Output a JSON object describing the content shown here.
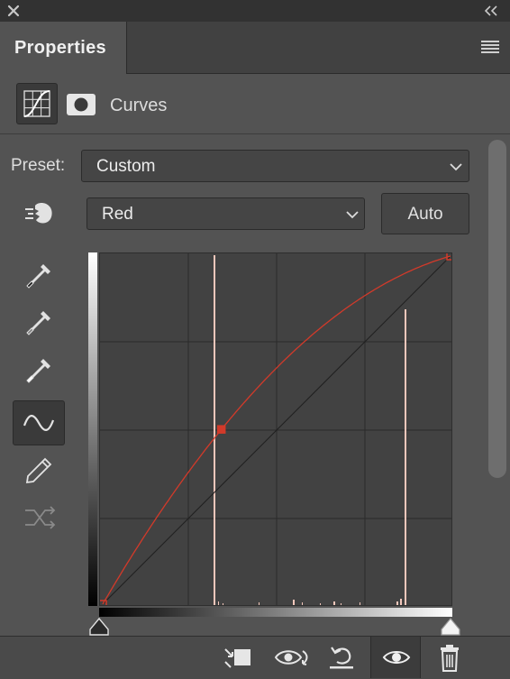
{
  "panel": {
    "tab_label": "Properties",
    "header_title": "Curves"
  },
  "preset": {
    "label": "Preset:",
    "value": "Custom"
  },
  "channel": {
    "value": "Red"
  },
  "auto": {
    "label": "Auto"
  },
  "curve": {
    "channel_color": "#d23a2a",
    "control_points": [
      [
        0,
        0
      ],
      [
        87,
        128
      ],
      [
        255,
        255
      ]
    ],
    "input_range": [
      0,
      255
    ],
    "output_range": [
      0,
      255
    ]
  },
  "icons": {
    "close": "close-icon",
    "collapse": "double-chevron-left-icon",
    "menu": "hamburger-menu-icon",
    "curves": "curves-adjustment-icon",
    "mask": "layer-mask-icon",
    "on_image": "on-image-adjust-hand-icon",
    "black_point": "black-point-eyedropper-icon",
    "gray_point": "gray-point-eyedropper-icon",
    "white_point": "white-point-eyedropper-icon",
    "edit_points": "edit-points-curve-icon",
    "pencil": "pencil-draw-icon",
    "smooth": "smooth-curve-icon",
    "clip": "clip-to-layer-icon",
    "view_previous": "view-previous-state-icon",
    "reset": "reset-icon",
    "visibility": "eye-icon",
    "delete": "trash-icon"
  }
}
